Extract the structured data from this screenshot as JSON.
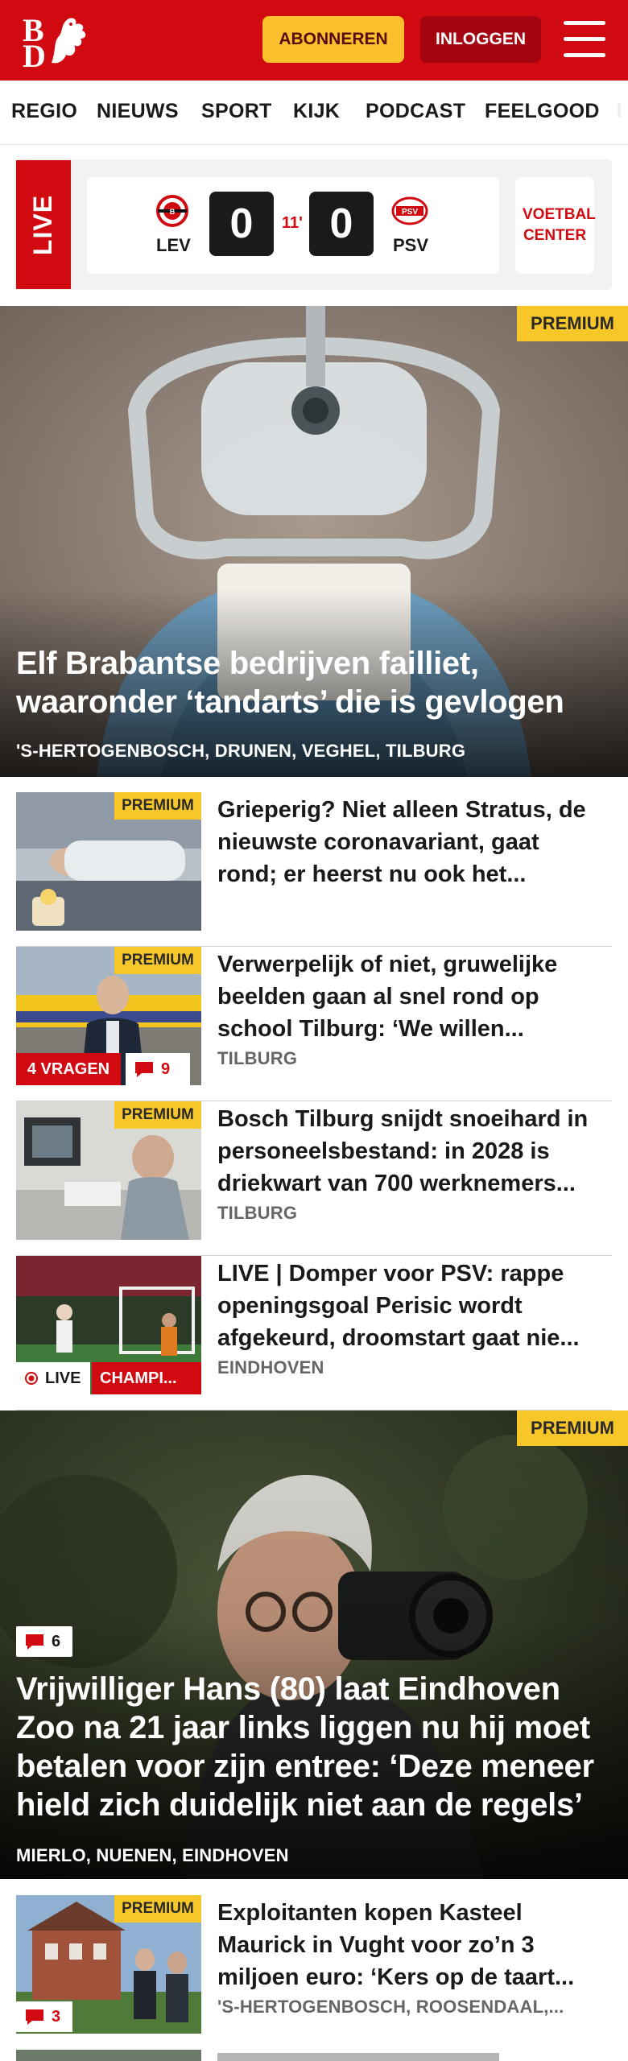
{
  "header": {
    "logo_top": "B",
    "logo_bottom": "D",
    "subscribe_label": "ABONNEREN",
    "login_label": "INLOGGEN"
  },
  "nav": {
    "items": [
      "REGIO",
      "NIEUWS",
      "SPORT",
      "KIJK",
      "PODCAST",
      "FEELGOOD",
      "I"
    ]
  },
  "live": {
    "tag": "LIVE",
    "home_team": "LEV",
    "away_team": "PSV",
    "home_score": "0",
    "away_score": "0",
    "minute": "11'",
    "voetbal_center": "VOETBAL CENTER"
  },
  "hero1": {
    "premium": "PREMIUM",
    "title_line1": "Elf Brabantse bedrijven failliet,",
    "title_line2": "waaronder ‘tandarts’ die is gevlogen",
    "location": "'S-HERTOGENBOSCH, DRUNEN, VEGHEL, TILBURG"
  },
  "articles": [
    {
      "premium": "PREMIUM",
      "title_lines": [
        "Grieperig? Niet alleen Stratus, de",
        "nieuwste coronavariant, gaat",
        "rond; er heerst nu ook het..."
      ],
      "location": ""
    },
    {
      "premium": "PREMIUM",
      "title_lines": [
        "Verwerpelijk of niet, gruwelijke",
        "beelden gaan al snel rond op",
        "school Tilburg: ‘We willen..."
      ],
      "location": "TILBURG",
      "badge": "4 VRAGEN",
      "comments": "9"
    },
    {
      "premium": "PREMIUM",
      "title_lines": [
        "Bosch Tilburg snijdt snoeihard in",
        "personeelsbestand: in 2028 is",
        "driekwart van 700 werknemers..."
      ],
      "location": "TILBURG"
    },
    {
      "title_lines": [
        "LIVE | Domper voor PSV: rappe",
        "openingsgoal Perisic wordt",
        "afgekeurd, droomstart gaat nie..."
      ],
      "location": "EINDHOVEN",
      "live_badge": "LIVE",
      "category_badge": "CHAMPI..."
    }
  ],
  "hero2": {
    "premium": "PREMIUM",
    "comments": "6",
    "title_lines": [
      "Vrijwilliger Hans (80) laat Eindhoven",
      "Zoo na 21 jaar links liggen nu hij moet",
      "betalen voor zijn entree: ‘Deze meneer",
      "hield zich duidelijk niet aan de regels’"
    ],
    "location": "MIERLO, NUENEN, EINDHOVEN"
  },
  "article_last": {
    "premium": "PREMIUM",
    "title_lines": [
      "Exploitanten kopen Kasteel",
      "Maurick in Vught voor zo’n 3",
      "miljoen euro: ‘Kers op de taart..."
    ],
    "location": "'S-HERTOGENBOSCH, ROOSENDAAL,...",
    "comments": "3"
  },
  "colors": {
    "brand_red": "#d10a11",
    "premium_yellow": "#f7c628",
    "subscribe_yellow": "#fbc02d"
  }
}
